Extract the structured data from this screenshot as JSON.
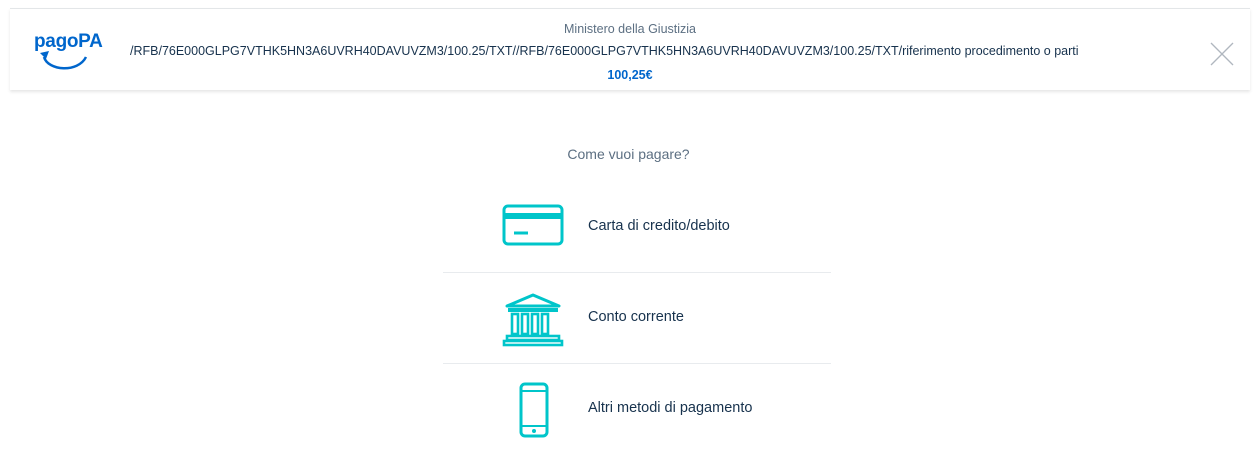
{
  "header": {
    "logo_text": "pagoPA",
    "org_name": "Ministero della Giustizia",
    "subject": "/RFB/76E000GLPG7VTHK5HN3A6UVRH40DAVUVZM3/100.25/TXT//RFB/76E000GLPG7VTHK5HN3A6UVRH40DAVUVZM3/100.25/TXT/riferimento procedimento o parti",
    "amount": "100,25€",
    "close_icon": "close-icon"
  },
  "main": {
    "question": "Come vuoi pagare?",
    "methods": [
      {
        "label": "Carta di credito/debito",
        "icon": "credit-card-icon"
      },
      {
        "label": "Conto corrente",
        "icon": "bank-icon"
      },
      {
        "label": "Altri metodi di pagamento",
        "icon": "smartphone-icon"
      }
    ]
  },
  "colors": {
    "brand": "#0066cc",
    "icon_accent": "#00c5ca",
    "text": "#17324d",
    "muted_text": "#5c6f82"
  }
}
